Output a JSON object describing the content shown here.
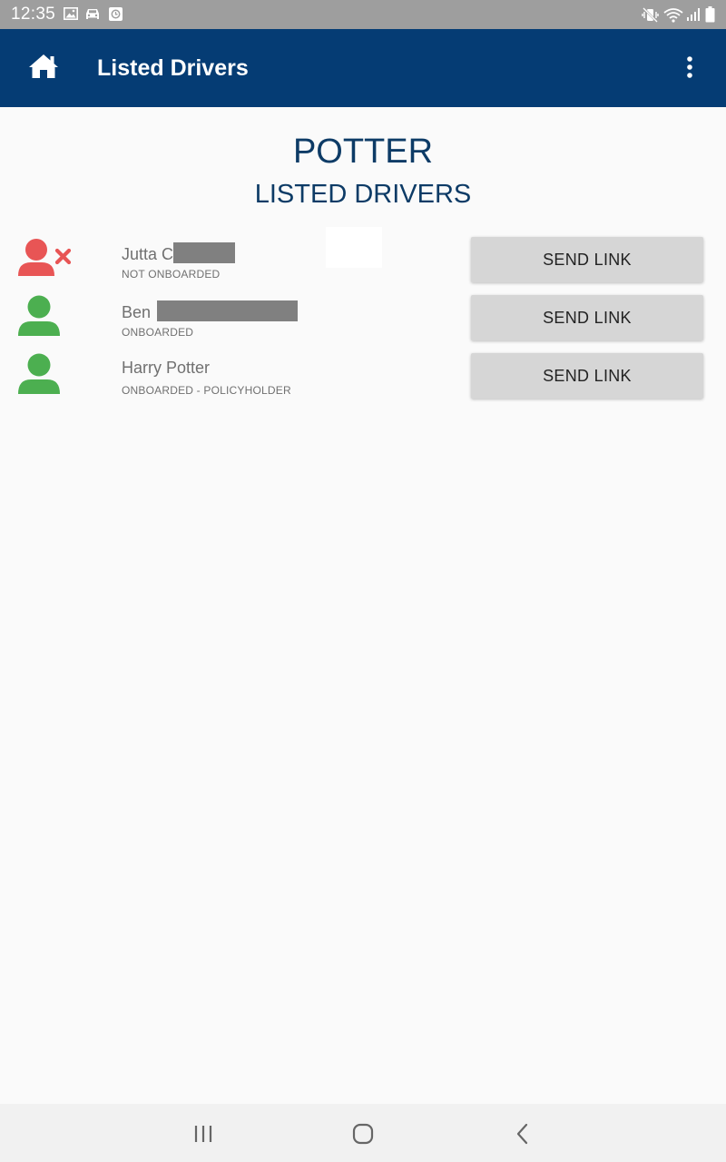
{
  "status_bar": {
    "time": "12:35",
    "icons_left": [
      "image-icon",
      "car-icon",
      "clock-app-icon"
    ],
    "icons_right": [
      "mute-vibrate-icon",
      "wifi-icon",
      "signal-icon",
      "battery-icon"
    ]
  },
  "app_bar": {
    "title": "Listed Drivers",
    "color": "#053c74"
  },
  "heading": {
    "title": "POTTER",
    "subtitle": "LISTED DRIVERS"
  },
  "drivers": [
    {
      "name": "Jutta C",
      "status": "NOT ONBOARDED",
      "onboarded": false,
      "button_label": "SEND LINK",
      "icon": "user-not-onboarded-icon",
      "icon_color": "#e85555"
    },
    {
      "name": "Ben",
      "status": "ONBOARDED",
      "onboarded": true,
      "button_label": "SEND LINK",
      "icon": "user-onboarded-icon",
      "icon_color": "#4caf50"
    },
    {
      "name": "Harry Potter",
      "status": "ONBOARDED - POLICYHOLDER",
      "onboarded": true,
      "button_label": "SEND LINK",
      "icon": "user-onboarded-icon",
      "icon_color": "#4caf50"
    }
  ],
  "nav_bar": {
    "icons": [
      "recent-apps-icon",
      "home-nav-icon",
      "back-nav-icon"
    ]
  }
}
